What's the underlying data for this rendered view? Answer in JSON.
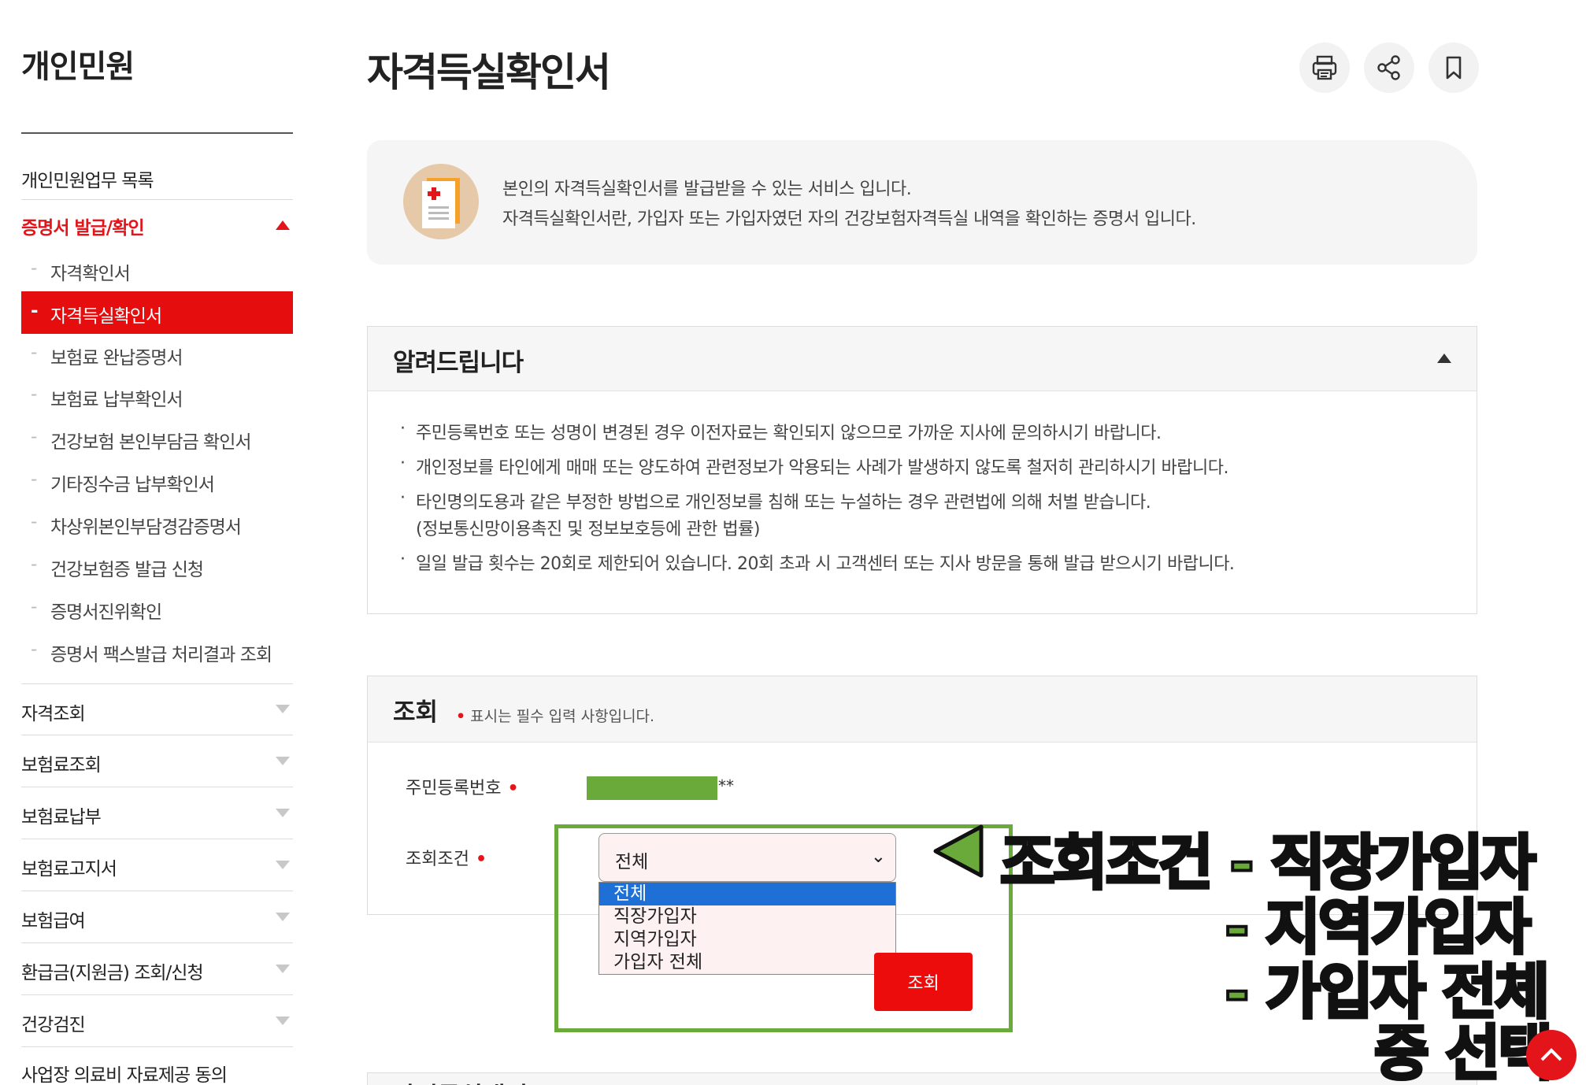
{
  "sidebar": {
    "title": "개인민원",
    "top_items": [
      {
        "label": "개인민원업무 목록"
      },
      {
        "label": "증명서 발급/확인"
      }
    ],
    "sub_items": [
      {
        "label": "자격확인서"
      },
      {
        "label": "자격득실확인서"
      },
      {
        "label": "보험료 완납증명서"
      },
      {
        "label": "보험료 납부확인서"
      },
      {
        "label": "건강보험 본인부담금 확인서"
      },
      {
        "label": "기타징수금 납부확인서"
      },
      {
        "label": "차상위본인부담경감증명서"
      },
      {
        "label": "건강보험증 발급 신청"
      },
      {
        "label": "증명서진위확인"
      },
      {
        "label": "증명서 팩스발급 처리결과 조회"
      }
    ],
    "bottom_items": [
      {
        "label": "자격조회"
      },
      {
        "label": "보험료조회"
      },
      {
        "label": "보험료납부"
      },
      {
        "label": "보험료고지서"
      },
      {
        "label": "보험급여"
      },
      {
        "label": "환급금(지원금) 조회/신청"
      },
      {
        "label": "건강검진"
      },
      {
        "label": "사업장 의료비 자료제공 동의"
      }
    ]
  },
  "page": {
    "title": "자격득실확인서",
    "actions": {
      "print": "print-icon",
      "share": "share-icon",
      "bookmark": "bookmark-icon"
    }
  },
  "info": {
    "line1": "본인의 자격득실확인서를 발급받을 수 있는 서비스 입니다.",
    "line2": "자격득실확인서란, 가입자 또는 가입자였던 자의 건강보험자격득실 내역을 확인하는 증명서 입니다."
  },
  "notice": {
    "title": "알려드립니다",
    "bullet": "·",
    "items": [
      "주민등록번호 또는 성명이 변경된 경우 이전자료는 확인되지 않으므로 가까운 지사에 문의하시기 바랍니다.",
      "개인정보를 타인에게 매매 또는 양도하여 관련정보가 악용되는 사례가 발생하지 않도록 철저히 관리하시기 바랍니다.",
      "타인명의도용과 같은 부정한 방법으로 개인정보를 침해 또는 누설하는 경우 관련법에 의해 처벌 받습니다.",
      "(정보통신망이용촉진 및 정보보호등에 관한 법률)",
      "일일 발급 횟수는 20회로 제한되어 있습니다. 20회 초과 시 고객센터 또는 지사 방문을 통해 발급 받으시기 바랍니다."
    ]
  },
  "search": {
    "title": "조회",
    "required_note": "표시는 필수 입력 사항입니다.",
    "required_mark": "•",
    "rrn_label": "주민등록번호",
    "rrn_suffix": "**",
    "condition_label": "조회조건",
    "selected": "전체",
    "chevron": "⌄",
    "options": [
      "전체",
      "직장가입자",
      "지역가입자",
      "가입자 전체"
    ],
    "button": "조회"
  },
  "next_section": {
    "title": "자격득실내역"
  },
  "annotation": {
    "line1": "조회조건 - 직장가입자",
    "line2": "- 지역가입자",
    "line3": "- 가입자 전체",
    "line4": "중 선택"
  },
  "colors": {
    "accent": "#e50d0d",
    "highlight_green": "#6aaa3a",
    "option_selected": "#1e6fd6"
  }
}
